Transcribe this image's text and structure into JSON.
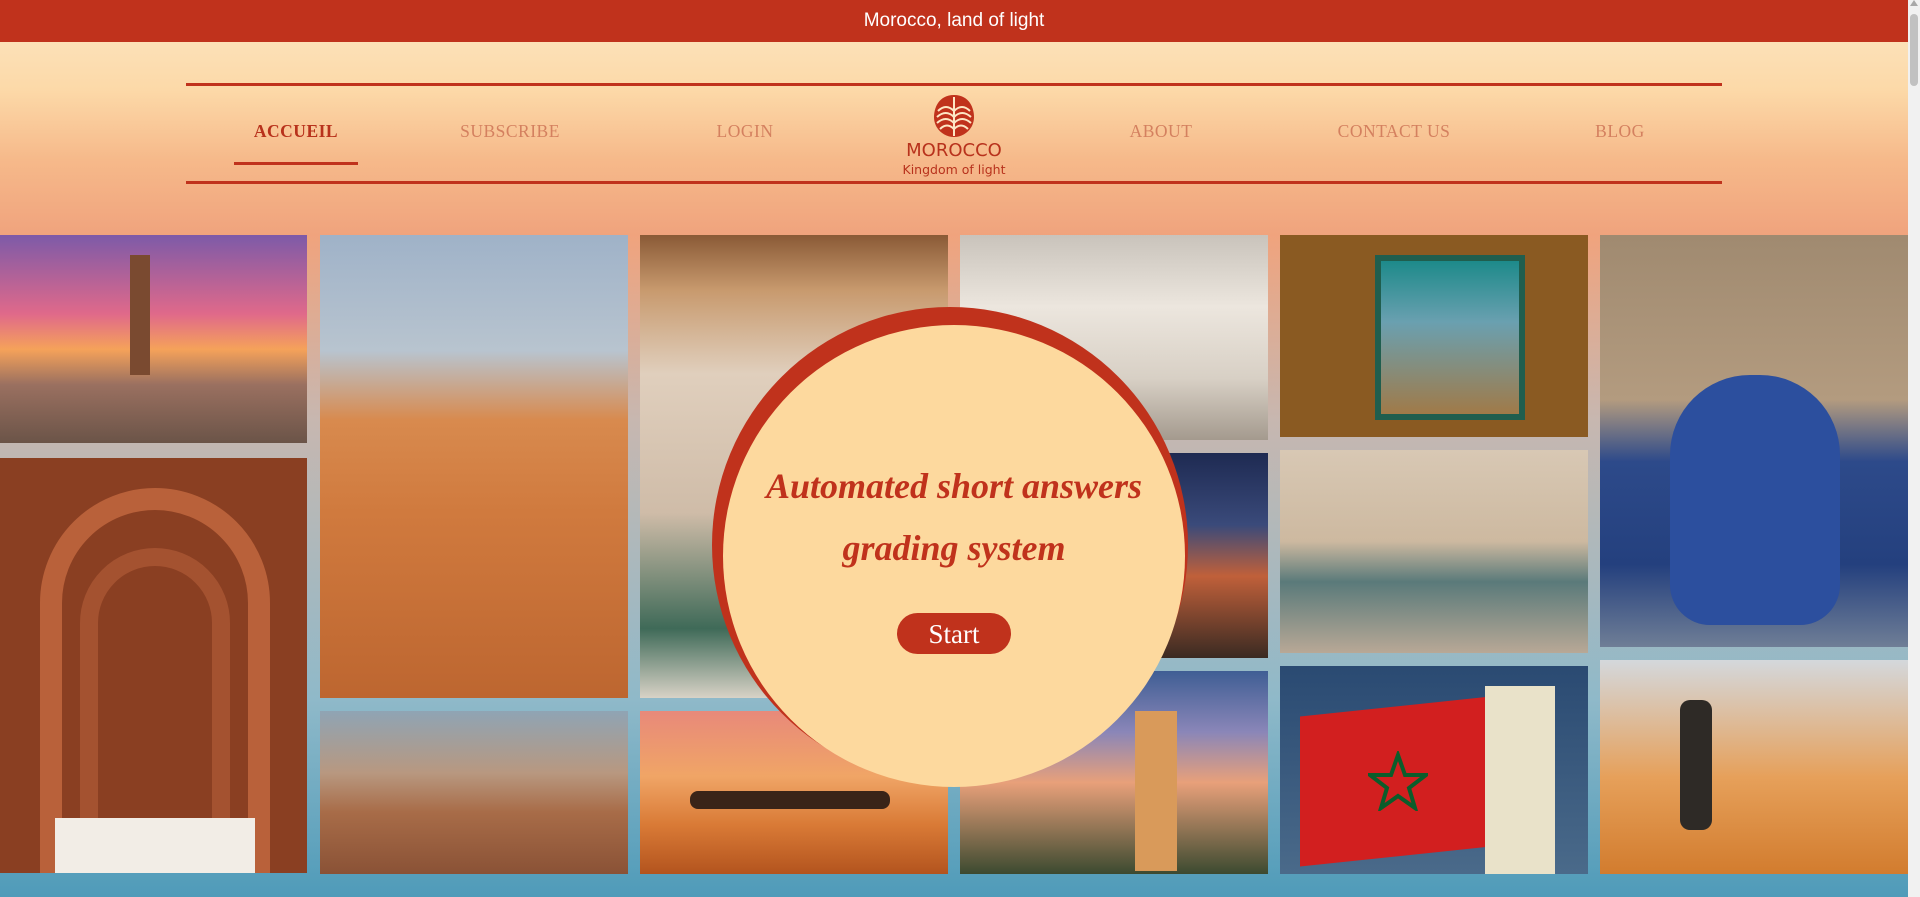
{
  "topbar": {
    "title": "Morocco, land of light"
  },
  "nav": {
    "items": [
      {
        "label": "ACCUEIL",
        "active": true
      },
      {
        "label": "SUBSCRIBE"
      },
      {
        "label": "LOGIN"
      },
      {
        "label": "ABOUT"
      },
      {
        "label": "CONTACT US"
      },
      {
        "label": "BLOG"
      }
    ],
    "logo": {
      "title": "MOROCCO",
      "subtitle": "Kingdom of light"
    }
  },
  "hero": {
    "title_line1": "Automated short answers",
    "title_line2": "grading system",
    "start_label": "Start"
  },
  "colors": {
    "brand": "#c0321c",
    "hero_fill": "#fdd99e",
    "nav_inactive": "#d4805f"
  }
}
